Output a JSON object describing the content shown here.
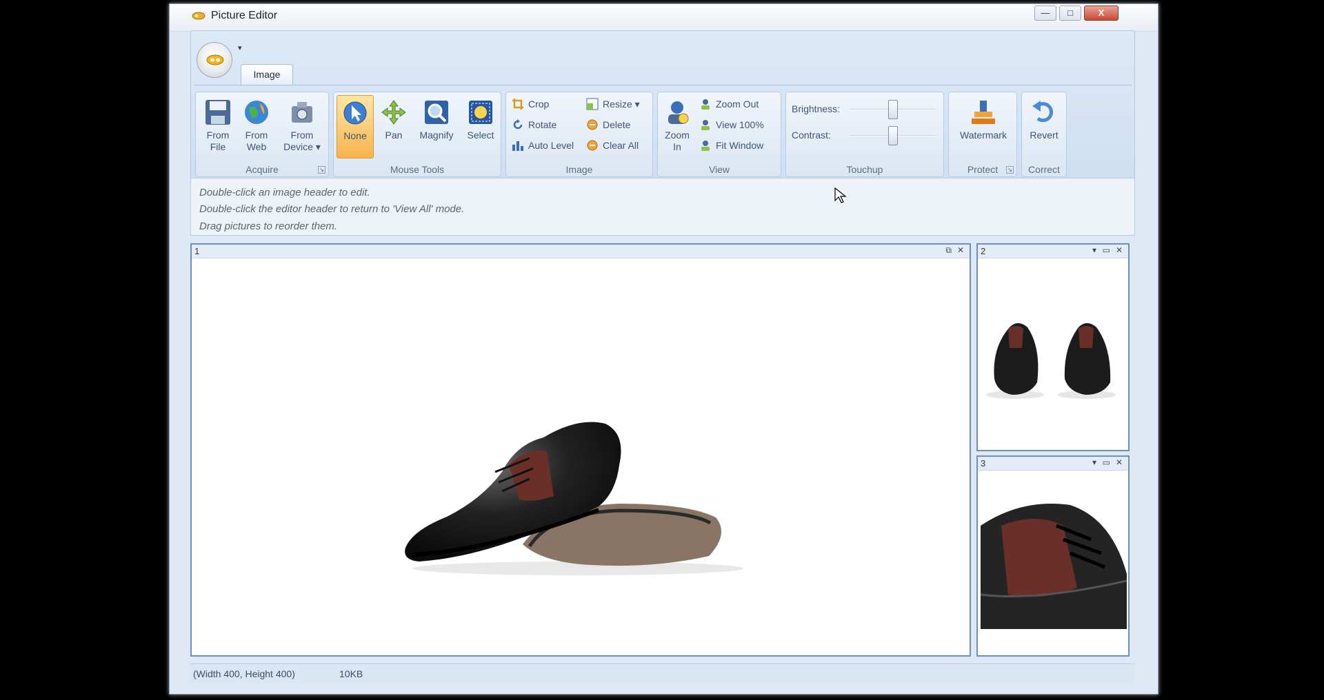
{
  "window": {
    "title": "Picture Editor",
    "minimize": "—",
    "maximize": "□",
    "close": "X"
  },
  "qat": {
    "label": "▾"
  },
  "tabs": [
    {
      "label": "Image"
    }
  ],
  "acquire": {
    "group_label": "Acquire",
    "buttons": [
      {
        "line1": "From",
        "line2": "File"
      },
      {
        "line1": "From",
        "line2": "Web"
      },
      {
        "line1": "From",
        "line2": "Device ▾"
      }
    ]
  },
  "mouse_tools": {
    "group_label": "Mouse Tools",
    "buttons": [
      {
        "label": "None"
      },
      {
        "label": "Pan"
      },
      {
        "label": "Magnify"
      },
      {
        "label": "Select"
      }
    ],
    "active": "None"
  },
  "image_group": {
    "group_label": "Image",
    "left": [
      {
        "label": "Crop"
      },
      {
        "label": "Rotate"
      },
      {
        "label": "Auto Level"
      }
    ],
    "right": [
      {
        "label": "Resize ▾"
      },
      {
        "label": "Delete"
      },
      {
        "label": "Clear All"
      }
    ]
  },
  "view_group": {
    "group_label": "View",
    "zoom_in": {
      "line1": "Zoom",
      "line2": "In"
    },
    "small": [
      {
        "label": "Zoom Out"
      },
      {
        "label": "View 100%"
      },
      {
        "label": "Fit Window"
      }
    ]
  },
  "touchup": {
    "group_label": "Touchup",
    "brightness_label": "Brightness:",
    "contrast_label": "Contrast:"
  },
  "protect": {
    "group_label": "Protect",
    "button": "Watermark"
  },
  "correct": {
    "group_label": "Correct",
    "button": "Revert"
  },
  "hints": [
    "Double-click an image header to edit.",
    "Double-click the editor header to return to 'View All' mode.",
    "Drag pictures to reorder them."
  ],
  "panels": [
    {
      "number": "1",
      "close": "✕",
      "restore": "⧉"
    },
    {
      "number": "2",
      "close": "✕",
      "max": "▭",
      "collapse": "▾"
    },
    {
      "number": "3",
      "close": "✕",
      "max": "▭",
      "collapse": "▾"
    }
  ],
  "status": {
    "dimensions": "(Width 400, Height 400)",
    "size": "10KB"
  },
  "colors": {
    "ribbon": "#dbe7f5",
    "active_button": "#f8b34c",
    "panel_border": "#6e8fb8"
  }
}
